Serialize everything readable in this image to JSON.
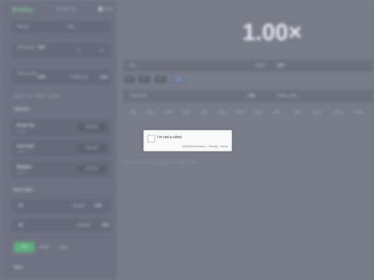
{
  "header": {
    "logo": "Stake",
    "nav_label": "Provably Fair",
    "account_label": "Stats"
  },
  "sidebar": {
    "mode_tabs": [
      "Manual",
      "Auto"
    ],
    "bet_amount_label": "Bet Amount",
    "bet_amount_value": "0.00",
    "half_label": "½",
    "double_label": "2×",
    "profit_label": "Profit on Win",
    "profit_value": "0.00",
    "cashout_label": "Cashout At",
    "cashout_value": "2.00",
    "info_text": "Balance · Profit · Wagered · Multiplier",
    "upgrades_title": "Upgrades",
    "upgrades": [
      {
        "name": "Rocket Tip",
        "sub": "Level 1",
        "action": "Upgrade"
      },
      {
        "name": "Auto Cash",
        "sub": "Level 1",
        "action": "Upgrade"
      },
      {
        "name": "Multiplier",
        "sub": "Level 1",
        "action": "Upgrade"
      }
    ],
    "boosts_title": "Boost Apps",
    "boosts": [
      {
        "name": "2X",
        "action": "Activate",
        "value": "2.00"
      },
      {
        "name": "3X",
        "action": "Activate",
        "value": "3.00"
      }
    ],
    "play_label": "Play",
    "reset_label": "Reset",
    "help_label": "Help",
    "stats_title": "Stats"
  },
  "main": {
    "multiplier": "1.00×",
    "bet_row": {
      "left": "Bet",
      "mid": "Target",
      "right": "2.00"
    },
    "chips": [
      "1×",
      "2×",
      "5×",
      "10×"
    ],
    "profit_row": {
      "left": "Total Profit",
      "mid": "0.00",
      "right": "Profit on Win"
    },
    "ticks": [
      "1.00x",
      "1.20x",
      "1.40x",
      "1.60x",
      "1.80x",
      "2.00x",
      "2.50x",
      "3.00x",
      "4.00x",
      "5.00x",
      "10.0x",
      "20.0x",
      "50.0x"
    ],
    "footnote": "Place a bet to start the round and watch the multiplier climb."
  },
  "captcha": {
    "label": "I'm not a robot",
    "brand": "reCAPTCHA demo",
    "separator": "–",
    "privacy": "Privacy",
    "dash": "-",
    "terms": "Terms"
  }
}
